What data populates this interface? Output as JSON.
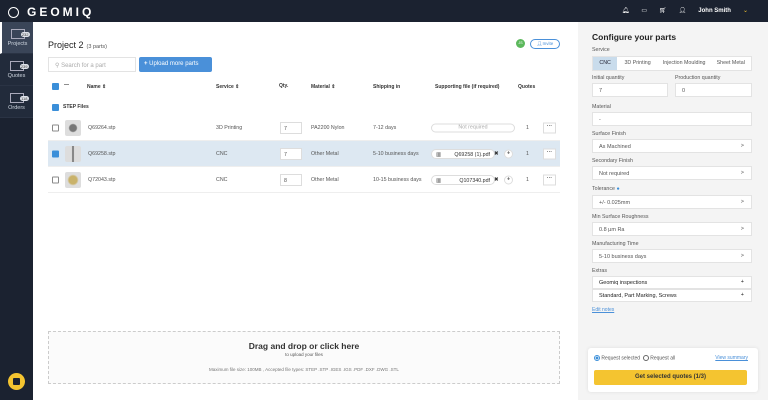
{
  "header": {
    "brand": "GEOMIQ",
    "user": "John Smith"
  },
  "sidebar": {
    "items": [
      {
        "label": "Projects",
        "badge": "232"
      },
      {
        "label": "Quotes",
        "badge": "239"
      },
      {
        "label": "Orders",
        "badge": "118"
      }
    ]
  },
  "project": {
    "title": "Project 2",
    "count": "(3 parts)",
    "avatar": "JS",
    "invite": "Invite",
    "search_placeholder": "Search for a part",
    "upload": "Upload more parts"
  },
  "table": {
    "headers": {
      "name": "Name ⇕",
      "service": "Service ⇕",
      "qty": "Qty.",
      "material": "Material ⇕",
      "shipping": "Shipping in",
      "supporting": "Supporting file (if required)",
      "quotes": "Quotes"
    },
    "group": "STEP Files",
    "rows": [
      {
        "name": "Q69264.stp",
        "service": "3D Printing",
        "qty": "7",
        "material": "PA2200 Nylon",
        "shipping": "7-12 days",
        "file": "Not required",
        "quotes": "1",
        "selected": false
      },
      {
        "name": "Q69258.stp",
        "service": "CNC",
        "qty": "7",
        "material": "Other Metal",
        "shipping": "5-10 business days",
        "file": "Q69258 (1).pdf",
        "quotes": "1",
        "selected": true
      },
      {
        "name": "Q72043.stp",
        "service": "CNC",
        "qty": "8",
        "material": "Other Metal",
        "shipping": "10-15 business days",
        "file": "Q107340.pdf",
        "quotes": "1",
        "selected": false
      }
    ]
  },
  "dropzone": {
    "title": "Drag and drop or click here",
    "subtitle": "to upload your files",
    "note": "Maximum file size: 100MB , Accepted file types: STEP .STP .IGES .IGS .PDF .DXF .DWG .STL"
  },
  "config": {
    "title": "Configure your parts",
    "service_label": "Service",
    "services": [
      "CNC",
      "3D Printing",
      "Injection Moulding",
      "Sheet Metal"
    ],
    "initial_qty_label": "Initial quantity",
    "initial_qty": "7",
    "production_qty_label": "Production quantity",
    "production_qty": "0",
    "material_label": "Material",
    "material": "-",
    "surface_label": "Surface Finish",
    "surface": "As Machined",
    "secondary_label": "Secondary Finish",
    "secondary": "Not required",
    "tolerance_label": "Tolerance",
    "tolerance": "+/- 0.025mm",
    "roughness_label": "Min Surface Roughness",
    "roughness": "0.8 µm Ra",
    "time_label": "Manufacturing Time",
    "time": "5-10 business days",
    "extras_label": "Extras",
    "extras": [
      "Geomiq inspections",
      "Standard, Part Marking, Screws"
    ],
    "edit_notes": "Edit notes",
    "request_selected": "Request selected",
    "request_all": "Request all",
    "view_summary": "View summary",
    "get_quotes": "Get selected quotes (1/3)"
  },
  "colors": {
    "accent": "#4a90d9",
    "cta": "#f4c430",
    "nav": "#1b2230"
  }
}
